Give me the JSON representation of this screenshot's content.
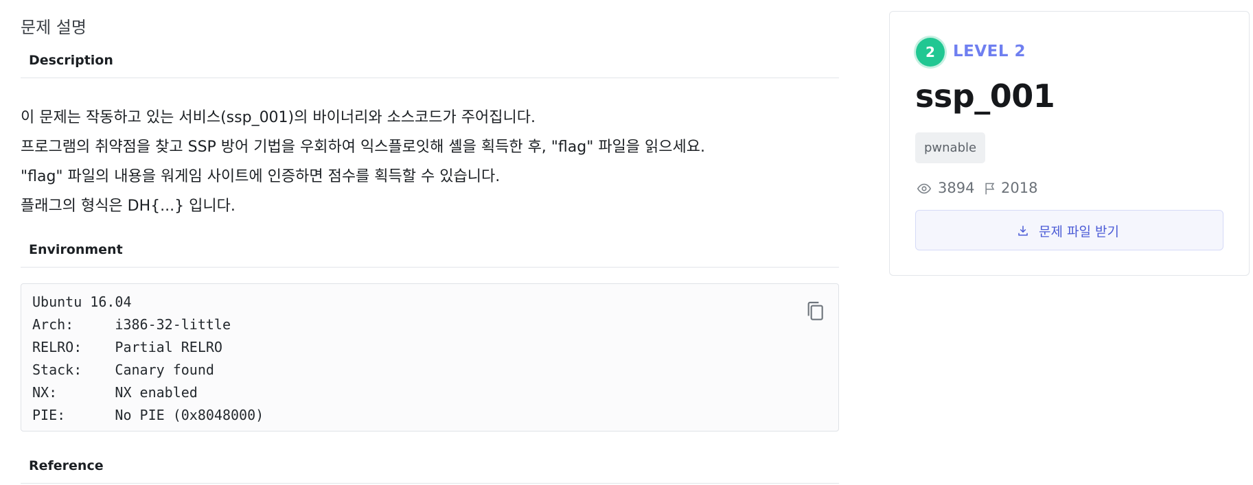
{
  "main": {
    "page_title": "문제 설명",
    "sections": {
      "description": "Description",
      "environment": "Environment",
      "reference": "Reference"
    },
    "description_lines": [
      "이 문제는 작동하고 있는 서비스(ssp_001)의 바이너리와 소스코드가 주어집니다.",
      "프로그램의 취약점을 찾고 SSP 방어 기법을 우회하여 익스플로잇해 셸을 획득한 후, \"flag\" 파일을 읽으세요.",
      "\"flag\" 파일의 내용을 워게임 사이트에 인증하면 점수를 획득할 수 있습니다.",
      "플래그의 형식은 DH{...} 입니다."
    ],
    "environment_code": "Ubuntu 16.04\nArch:     i386-32-little\nRELRO:    Partial RELRO\nStack:    Canary found\nNX:       NX enabled\nPIE:      No PIE (0x8048000)",
    "copy_icon": "copy-icon"
  },
  "side": {
    "level_number": "2",
    "level_label": "LEVEL 2",
    "title": "ssp_001",
    "tag": "pwnable",
    "views": "3894",
    "solves": "2018",
    "download_label": "문제 파일 받기",
    "colors": {
      "level_badge": "#21c792",
      "level_text": "#6f7ff0",
      "download_text": "#4b5bd6"
    }
  }
}
